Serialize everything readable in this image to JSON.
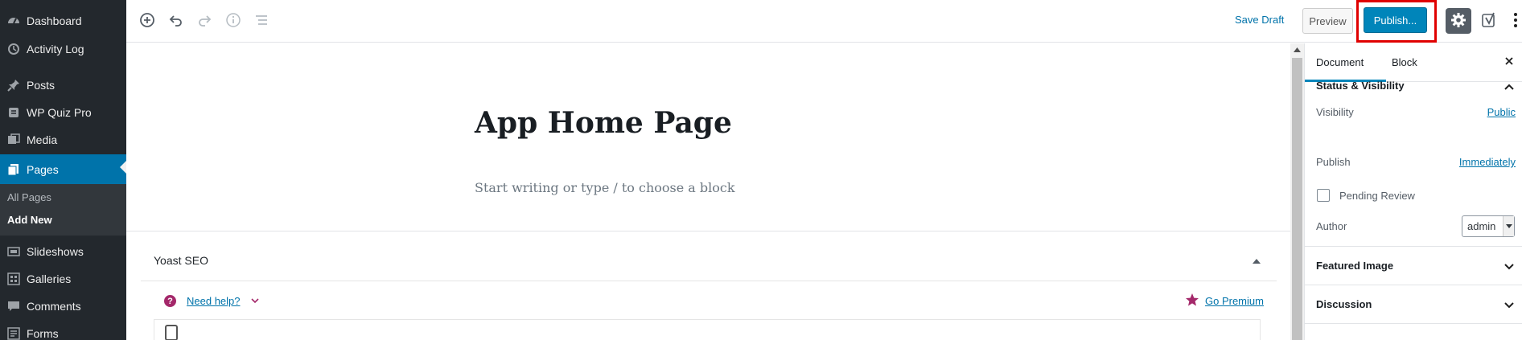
{
  "admin_menu": {
    "items": [
      {
        "label": "Dashboard",
        "icon": "dashboard-icon"
      },
      {
        "label": "Activity Log",
        "icon": "history-icon"
      },
      {
        "label": "Posts",
        "icon": "pushpin-icon"
      },
      {
        "label": "WP Quiz Pro",
        "icon": "quiz-icon"
      },
      {
        "label": "Media",
        "icon": "media-icon"
      },
      {
        "label": "Pages",
        "icon": "pages-icon",
        "current": true
      },
      {
        "label": "Slideshows",
        "icon": "slideshow-icon"
      },
      {
        "label": "Galleries",
        "icon": "gallery-icon"
      },
      {
        "label": "Comments",
        "icon": "comment-icon"
      },
      {
        "label": "Forms",
        "icon": "forms-icon"
      }
    ],
    "submenu": [
      {
        "label": "All Pages"
      },
      {
        "label": "Add New",
        "active": true
      }
    ]
  },
  "toolbar": {
    "left_icons": [
      "add-block-icon",
      "undo-icon",
      "redo-icon",
      "info-icon",
      "outline-icon"
    ],
    "save_draft": "Save Draft",
    "preview": "Preview",
    "publish": "Publish...",
    "right_icons": [
      "gear-icon",
      "yoast-icon",
      "more-vertical-icon"
    ]
  },
  "editor": {
    "title": "App Home Page",
    "placeholder": "Start writing or type / to choose a block"
  },
  "yoast": {
    "title": "Yoast SEO",
    "need_help": "Need help?",
    "go_premium": "Go Premium"
  },
  "sidebar": {
    "tabs": [
      "Document",
      "Block"
    ],
    "active_tab": "Document",
    "status_visibility": {
      "title": "Status & Visibility",
      "visibility_label": "Visibility",
      "visibility_value": "Public",
      "publish_label": "Publish",
      "publish_value": "Immediately",
      "pending_review": "Pending Review",
      "author_label": "Author",
      "author_value": "admin"
    },
    "featured_image": "Featured Image",
    "discussion": "Discussion"
  },
  "colors": {
    "admin_bg": "#23282d",
    "accent": "#0073aa",
    "publish_bg": "#0085ba",
    "highlight": "#e00000",
    "yoast": "#a4286a"
  }
}
